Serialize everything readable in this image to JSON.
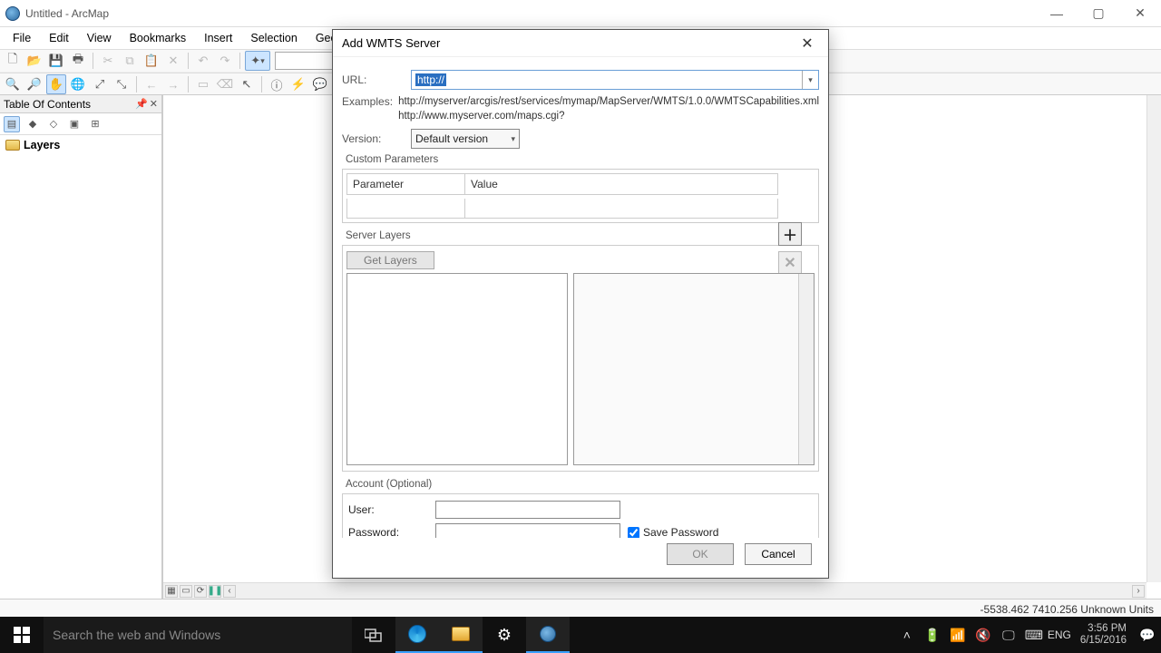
{
  "titlebar": {
    "title": "Untitled - ArcMap"
  },
  "menu": [
    "File",
    "Edit",
    "View",
    "Bookmarks",
    "Insert",
    "Selection",
    "Geoprocessing"
  ],
  "toc": {
    "header": "Table Of Contents",
    "layers_label": "Layers"
  },
  "statusbar": {
    "coords": "-5538.462  7410.256 Unknown Units"
  },
  "dialog": {
    "title": "Add WMTS Server",
    "url_label": "URL:",
    "url_value": "http://",
    "examples_label": "Examples:",
    "example1": "http://myserver/arcgis/rest/services/mymap/MapServer/WMTS/1.0.0/WMTSCapabilities.xml",
    "example2": "http://www.myserver.com/maps.cgi?",
    "version_label": "Version:",
    "version_value": "Default version",
    "custom_params_label": "Custom Parameters",
    "param_col": "Parameter",
    "value_col": "Value",
    "server_layers_label": "Server Layers",
    "get_layers": "Get Layers",
    "account_label": "Account (Optional)",
    "user_label": "User:",
    "password_label": "Password:",
    "save_pw_label": "Save Password",
    "ok": "OK",
    "cancel": "Cancel"
  },
  "taskbar": {
    "search_placeholder": "Search the web and Windows",
    "lang": "ENG",
    "time": "3:56 PM",
    "date": "6/15/2016"
  }
}
